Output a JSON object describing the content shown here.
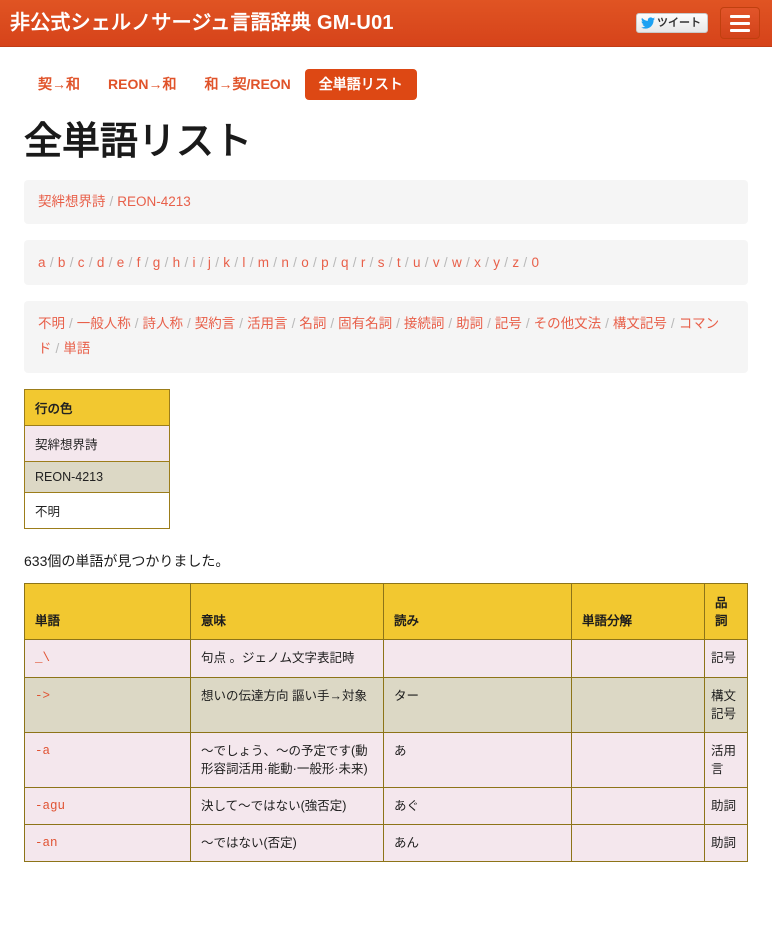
{
  "header": {
    "brand": "非公式シェルノサージュ言語辞典 GM-U01",
    "tweet_label": "ツイート",
    "menu_icon": "hamburger-icon",
    "bar_color": "#dc4b1e"
  },
  "tabs": [
    {
      "label": "契→和",
      "active": false
    },
    {
      "label": "REON→和",
      "active": false
    },
    {
      "label": "和→契/REON",
      "active": false
    },
    {
      "label": "全単語リスト",
      "active": true
    }
  ],
  "page": {
    "title": "全単語リスト",
    "count_text": "633個の単語が見つかりました。"
  },
  "breadcrumb": {
    "items": [
      "契絆想界詩",
      "REON-4213"
    ],
    "separator": "/"
  },
  "letters": {
    "items": [
      "a",
      "b",
      "c",
      "d",
      "e",
      "f",
      "g",
      "h",
      "i",
      "j",
      "k",
      "l",
      "m",
      "n",
      "o",
      "p",
      "q",
      "r",
      "s",
      "t",
      "u",
      "v",
      "w",
      "x",
      "y",
      "z",
      "0"
    ],
    "separator": "/"
  },
  "tags": {
    "items": [
      "不明",
      "一般人称",
      "詩人称",
      "契約言",
      "活用言",
      "名詞",
      "固有名詞",
      "接続詞",
      "助詞",
      "記号",
      "その他文法",
      "構文記号",
      "コマンド",
      "単語"
    ],
    "separator": "/"
  },
  "legend": {
    "header": "行の色",
    "rows": [
      {
        "label": "契絆想界詩",
        "color": "#f4e7ed"
      },
      {
        "label": "REON-4213",
        "color": "#dcd8c5"
      },
      {
        "label": "不明",
        "color": "#ffffff"
      }
    ],
    "header_color": "#f2c830"
  },
  "table": {
    "columns": [
      "単語",
      "意味",
      "読み",
      "単語分解",
      "品詞"
    ],
    "rows": [
      {
        "word": "_\\",
        "meaning": "句点 。ジェノム文字表記時",
        "reading": "",
        "decomposition": "",
        "pos": "記号",
        "row_color": "pink"
      },
      {
        "word": "->",
        "meaning": "想いの伝達方向 謳い手→対象",
        "reading": "ター",
        "decomposition": "",
        "pos": "構文記号",
        "row_color": "khaki"
      },
      {
        "word": "-a",
        "meaning": "～でしょう、～の予定です(動形容詞活用·能動·一般形·未来)",
        "reading": "あ",
        "decomposition": "",
        "pos": "活用言",
        "row_color": "pink"
      },
      {
        "word": "-agu",
        "meaning": "決して～ではない(強否定)",
        "reading": "あぐ",
        "decomposition": "",
        "pos": "助詞",
        "row_color": "pink"
      },
      {
        "word": "-an",
        "meaning": "～ではない(否定)",
        "reading": "あん",
        "decomposition": "",
        "pos": "助詞",
        "row_color": "pink"
      }
    ]
  }
}
